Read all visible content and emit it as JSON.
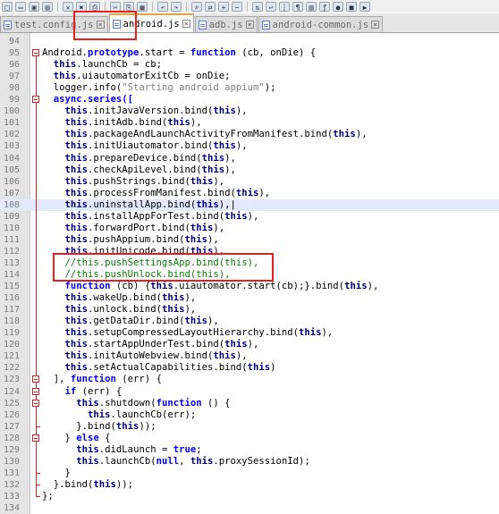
{
  "toolbar": {
    "icons": [
      "new-file-icon",
      "open-file-icon",
      "save-icon",
      "save-all-icon",
      "close-icon",
      "close-all-icon",
      "print-icon",
      "cut-icon",
      "copy-icon",
      "paste-icon",
      "undo-icon",
      "redo-icon",
      "find-icon",
      "replace-icon",
      "zoom-in-icon",
      "zoom-out-icon",
      "sync-icon",
      "wrap-icon",
      "indent-guide-icon",
      "all-chars-icon",
      "doc-map-icon",
      "function-list-icon",
      "macro-record-icon",
      "macro-stop-icon",
      "macro-play-icon"
    ]
  },
  "tabs": [
    {
      "label": "test.config.js",
      "active": false
    },
    {
      "label": "android.js",
      "active": true
    },
    {
      "label": "adb.js",
      "active": false
    },
    {
      "label": "android-common.js",
      "active": false
    }
  ],
  "code_lines": [
    {
      "n": "94",
      "segs": [
        {
          "t": "",
          "c": ""
        }
      ]
    },
    {
      "n": "95",
      "segs": [
        {
          "t": "Android.",
          "c": ""
        },
        {
          "t": "prototype",
          "c": "kw"
        },
        {
          "t": ".start = ",
          "c": ""
        },
        {
          "t": "function",
          "c": "kw"
        },
        {
          "t": " (cb, onDie) {",
          "c": ""
        }
      ]
    },
    {
      "n": "96",
      "segs": [
        {
          "t": "  ",
          "c": ""
        },
        {
          "t": "this",
          "c": "th"
        },
        {
          "t": ".launchCb = cb;",
          "c": ""
        }
      ]
    },
    {
      "n": "97",
      "segs": [
        {
          "t": "  ",
          "c": ""
        },
        {
          "t": "this",
          "c": "th"
        },
        {
          "t": ".uiautomatorExitCb = onDie;",
          "c": ""
        }
      ]
    },
    {
      "n": "98",
      "segs": [
        {
          "t": "  logger.info(",
          "c": ""
        },
        {
          "t": "\"Starting android appium\"",
          "c": "str"
        },
        {
          "t": ");",
          "c": ""
        }
      ]
    },
    {
      "n": "99",
      "segs": [
        {
          "t": "  async.series([",
          "c": "kw"
        }
      ]
    },
    {
      "n": "100",
      "segs": [
        {
          "t": "    ",
          "c": ""
        },
        {
          "t": "this",
          "c": "th"
        },
        {
          "t": ".initJavaVersion.bind(",
          "c": ""
        },
        {
          "t": "this",
          "c": "th"
        },
        {
          "t": "),",
          "c": ""
        }
      ]
    },
    {
      "n": "101",
      "segs": [
        {
          "t": "    ",
          "c": ""
        },
        {
          "t": "this",
          "c": "th"
        },
        {
          "t": ".initAdb.bind(",
          "c": ""
        },
        {
          "t": "this",
          "c": "th"
        },
        {
          "t": "),",
          "c": ""
        }
      ]
    },
    {
      "n": "102",
      "segs": [
        {
          "t": "    ",
          "c": ""
        },
        {
          "t": "this",
          "c": "th"
        },
        {
          "t": ".packageAndLaunchActivityFromManifest.bind(",
          "c": ""
        },
        {
          "t": "this",
          "c": "th"
        },
        {
          "t": "),",
          "c": ""
        }
      ]
    },
    {
      "n": "103",
      "segs": [
        {
          "t": "    ",
          "c": ""
        },
        {
          "t": "this",
          "c": "th"
        },
        {
          "t": ".initUiautomator.bind(",
          "c": ""
        },
        {
          "t": "this",
          "c": "th"
        },
        {
          "t": "),",
          "c": ""
        }
      ]
    },
    {
      "n": "104",
      "segs": [
        {
          "t": "    ",
          "c": ""
        },
        {
          "t": "this",
          "c": "th"
        },
        {
          "t": ".prepareDevice.bind(",
          "c": ""
        },
        {
          "t": "this",
          "c": "th"
        },
        {
          "t": "),",
          "c": ""
        }
      ]
    },
    {
      "n": "105",
      "segs": [
        {
          "t": "    ",
          "c": ""
        },
        {
          "t": "this",
          "c": "th"
        },
        {
          "t": ".checkApiLevel.bind(",
          "c": ""
        },
        {
          "t": "this",
          "c": "th"
        },
        {
          "t": "),",
          "c": ""
        }
      ]
    },
    {
      "n": "106",
      "segs": [
        {
          "t": "    ",
          "c": ""
        },
        {
          "t": "this",
          "c": "th"
        },
        {
          "t": ".pushStrings.bind(",
          "c": ""
        },
        {
          "t": "this",
          "c": "th"
        },
        {
          "t": "),",
          "c": ""
        }
      ]
    },
    {
      "n": "107",
      "segs": [
        {
          "t": "    ",
          "c": ""
        },
        {
          "t": "this",
          "c": "th"
        },
        {
          "t": ".processFromManifest.bind(",
          "c": ""
        },
        {
          "t": "this",
          "c": "th"
        },
        {
          "t": "),",
          "c": ""
        }
      ]
    },
    {
      "n": "108",
      "hl": true,
      "segs": [
        {
          "t": "    ",
          "c": ""
        },
        {
          "t": "this",
          "c": "th"
        },
        {
          "t": ".uninstallApp.bind(",
          "c": ""
        },
        {
          "t": "this",
          "c": "th"
        },
        {
          "t": "),|",
          "c": ""
        }
      ]
    },
    {
      "n": "109",
      "segs": [
        {
          "t": "    ",
          "c": ""
        },
        {
          "t": "this",
          "c": "th"
        },
        {
          "t": ".installAppForTest.bind(",
          "c": ""
        },
        {
          "t": "this",
          "c": "th"
        },
        {
          "t": "),",
          "c": ""
        }
      ]
    },
    {
      "n": "110",
      "segs": [
        {
          "t": "    ",
          "c": ""
        },
        {
          "t": "this",
          "c": "th"
        },
        {
          "t": ".forwardPort.bind(",
          "c": ""
        },
        {
          "t": "this",
          "c": "th"
        },
        {
          "t": "),",
          "c": ""
        }
      ]
    },
    {
      "n": "111",
      "segs": [
        {
          "t": "    ",
          "c": ""
        },
        {
          "t": "this",
          "c": "th"
        },
        {
          "t": ".pushAppium.bind(",
          "c": ""
        },
        {
          "t": "this",
          "c": "th"
        },
        {
          "t": "),",
          "c": ""
        }
      ]
    },
    {
      "n": "112",
      "segs": [
        {
          "t": "    ",
          "c": ""
        },
        {
          "t": "this",
          "c": "th"
        },
        {
          "t": ".initUnicode.bind(",
          "c": ""
        },
        {
          "t": "this",
          "c": "th"
        },
        {
          "t": "),",
          "c": ""
        }
      ]
    },
    {
      "n": "113",
      "segs": [
        {
          "t": "    //this.pushSettingsApp.bind(this),",
          "c": "cmt"
        }
      ]
    },
    {
      "n": "114",
      "segs": [
        {
          "t": "    //this.pushUnlock.bind(this),",
          "c": "cmt"
        }
      ]
    },
    {
      "n": "115",
      "segs": [
        {
          "t": "    ",
          "c": ""
        },
        {
          "t": "function",
          "c": "kw"
        },
        {
          "t": " (cb) {",
          "c": ""
        },
        {
          "t": "this",
          "c": "th"
        },
        {
          "t": ".uiautomator.start(cb);}.bind(",
          "c": ""
        },
        {
          "t": "this",
          "c": "th"
        },
        {
          "t": "),",
          "c": ""
        }
      ]
    },
    {
      "n": "116",
      "segs": [
        {
          "t": "    ",
          "c": ""
        },
        {
          "t": "this",
          "c": "th"
        },
        {
          "t": ".wakeUp.bind(",
          "c": ""
        },
        {
          "t": "this",
          "c": "th"
        },
        {
          "t": "),",
          "c": ""
        }
      ]
    },
    {
      "n": "117",
      "segs": [
        {
          "t": "    ",
          "c": ""
        },
        {
          "t": "this",
          "c": "th"
        },
        {
          "t": ".unlock.bind(",
          "c": ""
        },
        {
          "t": "this",
          "c": "th"
        },
        {
          "t": "),",
          "c": ""
        }
      ]
    },
    {
      "n": "118",
      "segs": [
        {
          "t": "    ",
          "c": ""
        },
        {
          "t": "this",
          "c": "th"
        },
        {
          "t": ".getDataDir.bind(",
          "c": ""
        },
        {
          "t": "this",
          "c": "th"
        },
        {
          "t": "),",
          "c": ""
        }
      ]
    },
    {
      "n": "119",
      "segs": [
        {
          "t": "    ",
          "c": ""
        },
        {
          "t": "this",
          "c": "th"
        },
        {
          "t": ".setupCompressedLayoutHierarchy.bind(",
          "c": ""
        },
        {
          "t": "this",
          "c": "th"
        },
        {
          "t": "),",
          "c": ""
        }
      ]
    },
    {
      "n": "120",
      "segs": [
        {
          "t": "    ",
          "c": ""
        },
        {
          "t": "this",
          "c": "th"
        },
        {
          "t": ".startAppUnderTest.bind(",
          "c": ""
        },
        {
          "t": "this",
          "c": "th"
        },
        {
          "t": "),",
          "c": ""
        }
      ]
    },
    {
      "n": "121",
      "segs": [
        {
          "t": "    ",
          "c": ""
        },
        {
          "t": "this",
          "c": "th"
        },
        {
          "t": ".initAutoWebview.bind(",
          "c": ""
        },
        {
          "t": "this",
          "c": "th"
        },
        {
          "t": "),",
          "c": ""
        }
      ]
    },
    {
      "n": "122",
      "segs": [
        {
          "t": "    ",
          "c": ""
        },
        {
          "t": "this",
          "c": "th"
        },
        {
          "t": ".setActualCapabilities.bind(",
          "c": ""
        },
        {
          "t": "this",
          "c": "th"
        },
        {
          "t": ")",
          "c": ""
        }
      ]
    },
    {
      "n": "123",
      "segs": [
        {
          "t": "  ], ",
          "c": ""
        },
        {
          "t": "function",
          "c": "kw"
        },
        {
          "t": " (err) {",
          "c": ""
        }
      ]
    },
    {
      "n": "124",
      "segs": [
        {
          "t": "    ",
          "c": ""
        },
        {
          "t": "if",
          "c": "kw"
        },
        {
          "t": " (err) {",
          "c": ""
        }
      ]
    },
    {
      "n": "125",
      "segs": [
        {
          "t": "      ",
          "c": ""
        },
        {
          "t": "this",
          "c": "th"
        },
        {
          "t": ".shutdown(",
          "c": ""
        },
        {
          "t": "function",
          "c": "kw"
        },
        {
          "t": " () {",
          "c": ""
        }
      ]
    },
    {
      "n": "126",
      "segs": [
        {
          "t": "        ",
          "c": ""
        },
        {
          "t": "this",
          "c": "th"
        },
        {
          "t": ".launchCb(err);",
          "c": ""
        }
      ]
    },
    {
      "n": "127",
      "segs": [
        {
          "t": "      }.bind(",
          "c": ""
        },
        {
          "t": "this",
          "c": "th"
        },
        {
          "t": "));",
          "c": ""
        }
      ]
    },
    {
      "n": "128",
      "segs": [
        {
          "t": "    } ",
          "c": ""
        },
        {
          "t": "else",
          "c": "kw"
        },
        {
          "t": " {",
          "c": ""
        }
      ]
    },
    {
      "n": "129",
      "segs": [
        {
          "t": "      ",
          "c": ""
        },
        {
          "t": "this",
          "c": "th"
        },
        {
          "t": ".didLaunch = ",
          "c": ""
        },
        {
          "t": "true",
          "c": "kw"
        },
        {
          "t": ";",
          "c": ""
        }
      ]
    },
    {
      "n": "130",
      "segs": [
        {
          "t": "      ",
          "c": ""
        },
        {
          "t": "this",
          "c": "th"
        },
        {
          "t": ".launchCb(",
          "c": ""
        },
        {
          "t": "null",
          "c": "kw"
        },
        {
          "t": ", ",
          "c": ""
        },
        {
          "t": "this",
          "c": "th"
        },
        {
          "t": ".proxySessionId);",
          "c": ""
        }
      ]
    },
    {
      "n": "131",
      "segs": [
        {
          "t": "    }",
          "c": ""
        }
      ]
    },
    {
      "n": "132",
      "segs": [
        {
          "t": "  }.bind(",
          "c": ""
        },
        {
          "t": "this",
          "c": "th"
        },
        {
          "t": "));",
          "c": ""
        }
      ]
    },
    {
      "n": "133",
      "segs": [
        {
          "t": "};",
          "c": ""
        }
      ]
    },
    {
      "n": "134",
      "segs": [
        {
          "t": "",
          "c": ""
        }
      ]
    }
  ],
  "colors": {
    "annotation": "#e52020",
    "keyword": "#0000ff",
    "comment": "#008000",
    "string": "#808080"
  }
}
